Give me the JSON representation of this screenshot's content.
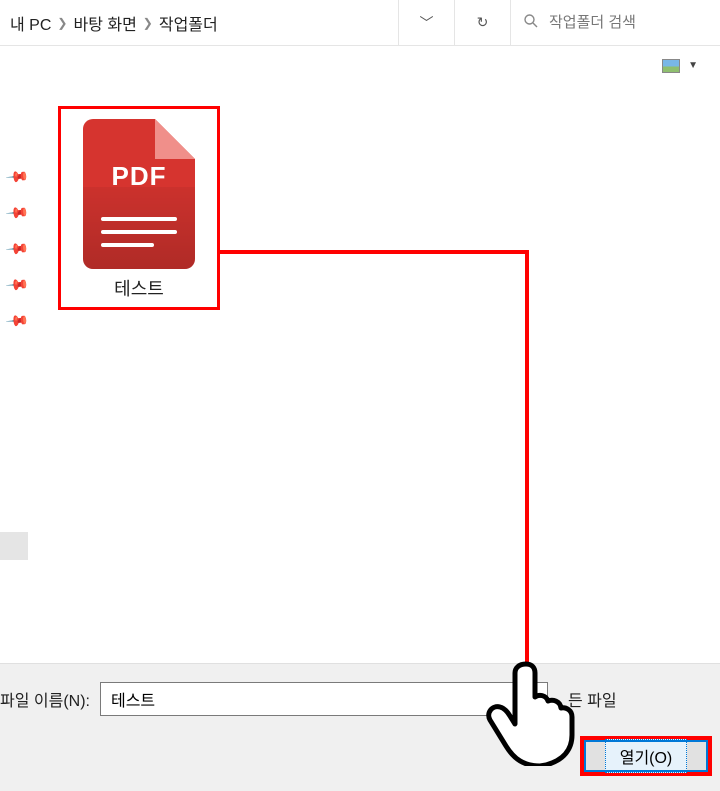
{
  "breadcrumb": {
    "parts": [
      "내 PC",
      "바탕 화면",
      "작업폴더"
    ]
  },
  "search": {
    "placeholder": "작업폴더 검색"
  },
  "file": {
    "icon_label": "PDF",
    "name": "테스트"
  },
  "bottom": {
    "filename_label": "파일 이름(N):",
    "filename_value": "테스트",
    "filter_text": "든 파일",
    "open_label": "열기(O)"
  },
  "icons": {
    "search": "search-icon",
    "refresh": "refresh-icon",
    "chevron_down": "chevron-down-icon",
    "pin": "pin-icon",
    "image_thumb": "image-thumb-icon",
    "hand_pointer": "hand-pointer-icon"
  }
}
